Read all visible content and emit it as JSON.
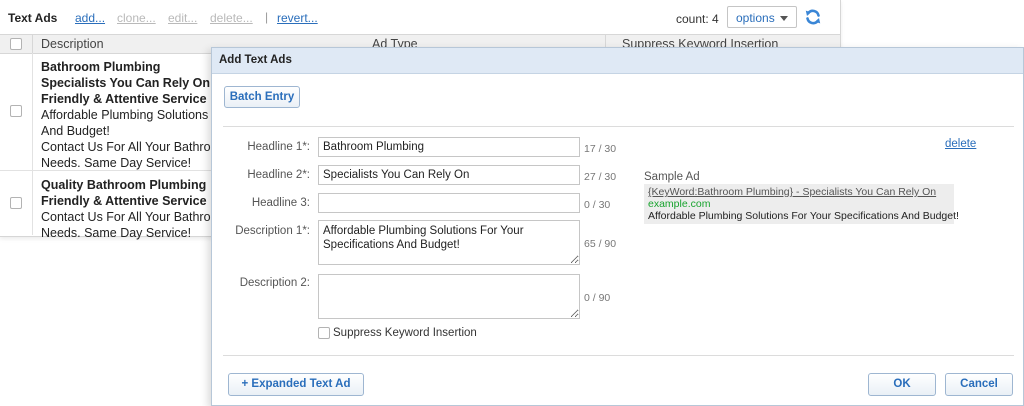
{
  "grid": {
    "title": "Text Ads",
    "actions": {
      "add": "add...",
      "clone": "clone...",
      "edit": "edit...",
      "delete": "delete...",
      "revert": "revert..."
    },
    "separator": "|",
    "count": "count: 4",
    "options_label": "options",
    "refresh_icon": "refresh-icon",
    "columns": {
      "description": "Description",
      "ad_type": "Ad Type",
      "suppress": "Suppress Keyword Insertion"
    },
    "rows": [
      {
        "headline_lines": [
          "Bathroom Plumbing",
          "Specialists You Can Rely On",
          "Friendly & Attentive Service"
        ],
        "desc_lines": [
          "Affordable Plumbing Solutions",
          "And Budget!",
          "Contact Us For All Your Bathro",
          "Needs. Same Day Service!"
        ]
      },
      {
        "headline_lines": [
          "Quality Bathroom Plumbing",
          "Friendly & Attentive Service"
        ],
        "desc_lines": [
          "Contact Us For All Your Bathro",
          "Needs. Same Day Service!"
        ]
      }
    ]
  },
  "dialog": {
    "title": "Add Text Ads",
    "batch_entry": "Batch Entry",
    "headline1": {
      "label": "Headline 1*:",
      "value": "Bathroom Plumbing",
      "count": "17 / 30"
    },
    "headline2": {
      "label": "Headline 2*:",
      "value": "Specialists You Can Rely On",
      "count": "27 / 30"
    },
    "headline3": {
      "label": "Headline 3:",
      "value": "",
      "count": "0 / 30"
    },
    "description1": {
      "label": "Description 1*:",
      "value": "Affordable Plumbing Solutions For Your Specifications And Budget!",
      "count": "65 / 90"
    },
    "description2": {
      "label": "Description 2:",
      "value": "",
      "count": "0 / 90"
    },
    "suppress_label": "Suppress Keyword Insertion",
    "delete": "delete",
    "sample": {
      "label": "Sample Ad",
      "headline": "{KeyWord:Bathroom Plumbing} - Specialists You Can Rely On",
      "url": "example.com",
      "description": "Affordable Plumbing Solutions For Your Specifications And Budget!"
    },
    "expanded_button": "+ Expanded Text Ad",
    "ok": "OK",
    "cancel": "Cancel"
  },
  "colors": {
    "link": "#2a6ebb",
    "disabled": "#b9b9b9",
    "url_green": "#18a32e",
    "titlebar": "#dfe9f5"
  }
}
